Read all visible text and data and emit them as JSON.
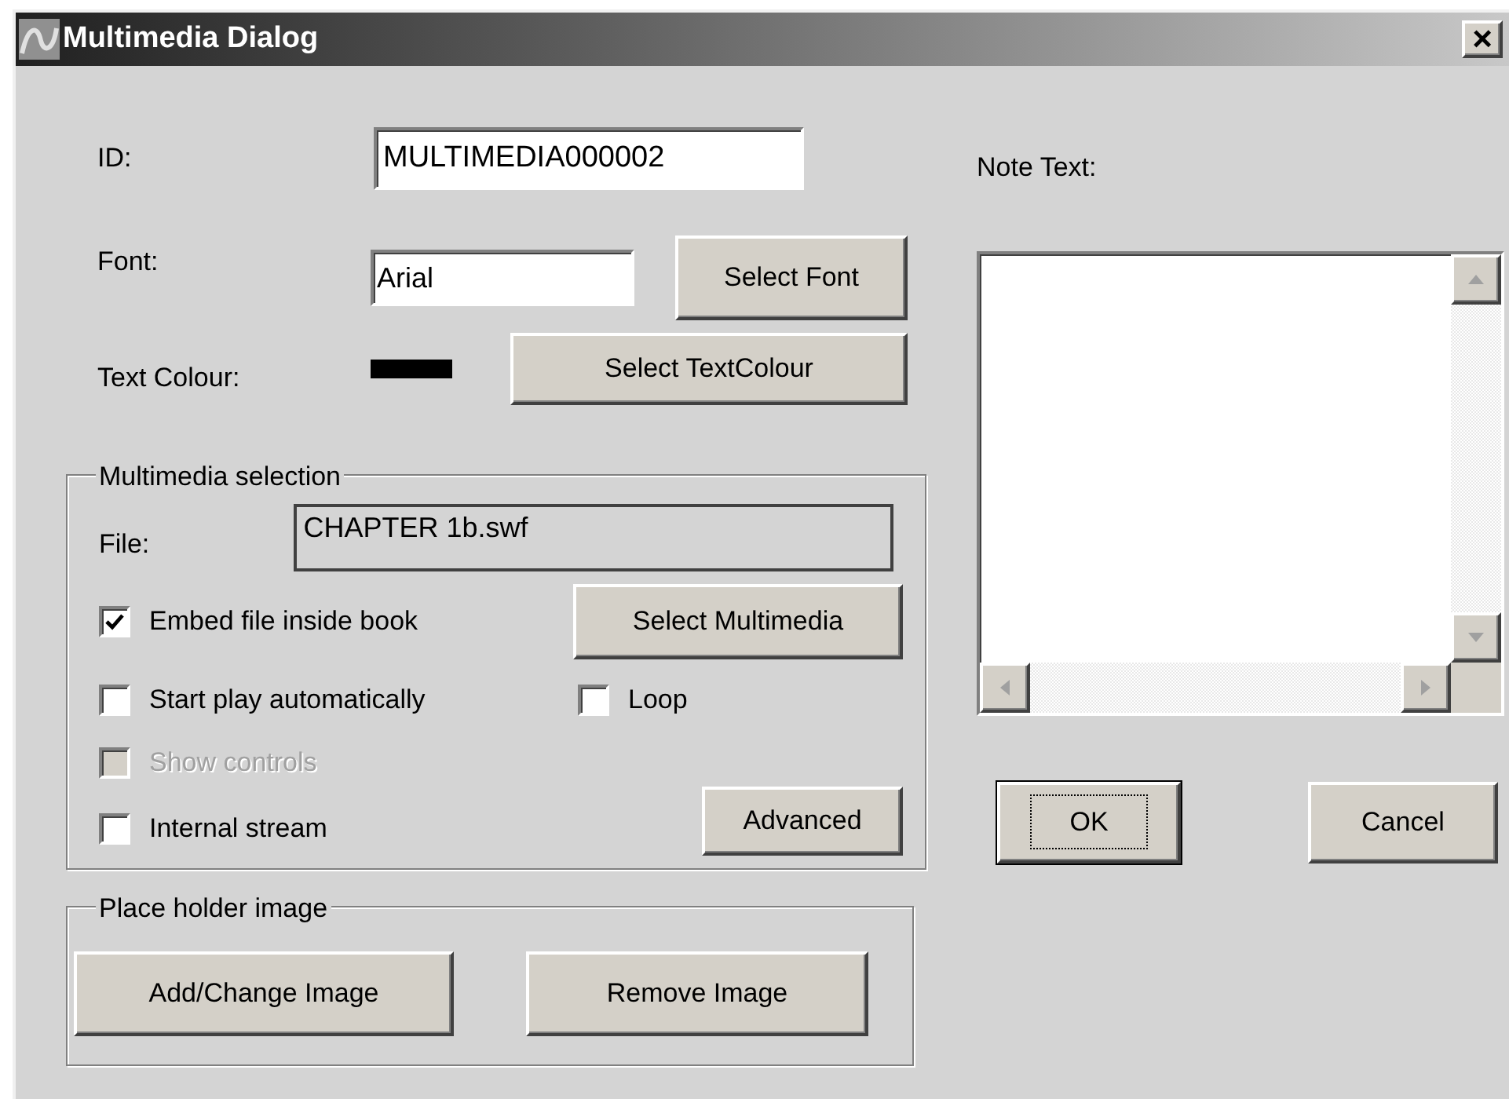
{
  "window": {
    "title": "Multimedia Dialog",
    "close": "×"
  },
  "id_field": {
    "label": "ID:",
    "value": "MULTIMEDIA000002"
  },
  "font_field": {
    "label": "Font:",
    "value": "Arial",
    "button": "Select Font"
  },
  "text_colour": {
    "label": "Text Colour:",
    "color": "#000000",
    "button": "Select TextColour"
  },
  "multimedia": {
    "legend": "Multimedia selection",
    "file_label": "File:",
    "file_value": "CHAPTER 1b.swf",
    "select_button": "Select Multimedia",
    "advanced_button": "Advanced",
    "embed": {
      "label": "Embed file inside book",
      "checked": true,
      "disabled": false
    },
    "start_play": {
      "label": "Start play automatically",
      "checked": false,
      "disabled": false
    },
    "loop": {
      "label": "Loop",
      "checked": false,
      "disabled": false
    },
    "show_controls": {
      "label": "Show controls",
      "checked": false,
      "disabled": true
    },
    "internal_stream": {
      "label": "Internal stream",
      "checked": false,
      "disabled": false
    }
  },
  "placeholder_image": {
    "legend": "Place holder image",
    "buttons": [
      "Add/Change Image",
      "Remove Image"
    ]
  },
  "note": {
    "label": "Note Text:"
  },
  "ok_button": {
    "label": "OK",
    "focused": true
  },
  "cancel_button": {
    "label": "Cancel",
    "focused": false
  }
}
